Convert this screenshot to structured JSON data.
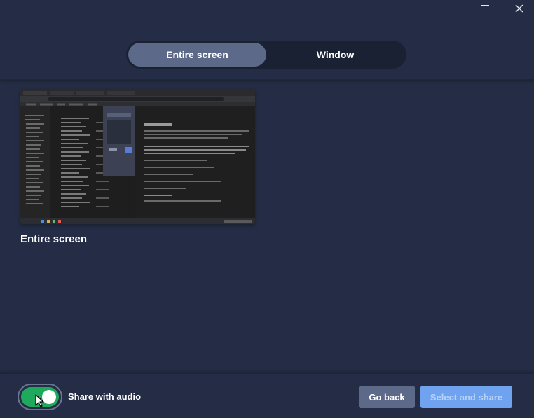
{
  "window_controls": {
    "minimize": "minimize-icon",
    "close": "close-icon"
  },
  "tabs": [
    {
      "label": "Entire screen",
      "active": true
    },
    {
      "label": "Window",
      "active": false
    }
  ],
  "sources": [
    {
      "label": "Entire screen"
    }
  ],
  "footer": {
    "audio_label": "Share with audio",
    "audio_enabled": true,
    "back_label": "Go back",
    "share_label": "Select and share"
  },
  "colors": {
    "background": "#242d45",
    "tab_active": "#5d6988",
    "toggle_on": "#1ea95c",
    "primary_disabled": "#6fa3f0"
  }
}
